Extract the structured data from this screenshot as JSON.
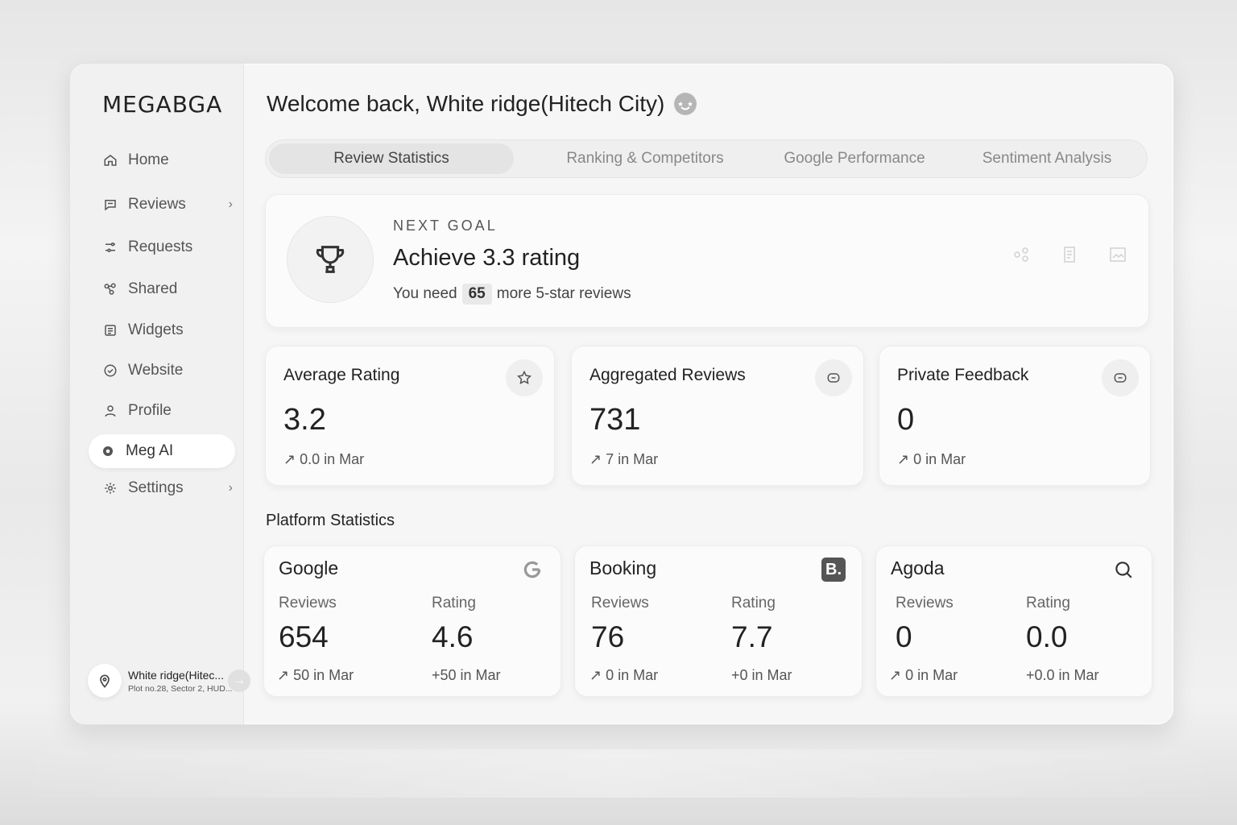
{
  "app": {
    "logo": "MEGABGA"
  },
  "header": {
    "welcome": "Welcome back, White ridge(Hitech City)"
  },
  "sidebar": {
    "items": [
      {
        "label": "Home",
        "icon": "home-icon"
      },
      {
        "label": "Reviews",
        "icon": "chat-icon",
        "has_chevron": true
      },
      {
        "label": "Requests",
        "icon": "sliders-icon"
      },
      {
        "label": "Shared",
        "icon": "share-icon"
      },
      {
        "label": "Widgets",
        "icon": "widget-icon"
      },
      {
        "label": "Website",
        "icon": "check-circle-icon"
      },
      {
        "label": "Profile",
        "icon": "user-icon"
      },
      {
        "label": "Meg AI",
        "icon": "ai-dot-icon",
        "active": true
      },
      {
        "label": "Settings",
        "icon": "gear-icon",
        "has_chevron": true
      }
    ],
    "chevron": "›",
    "account": {
      "name": "White ridge(Hitec...",
      "address": "Plot no.28, Sector 2, HUD...",
      "arrow": "→"
    }
  },
  "tabs": [
    {
      "label": "Review Statistics",
      "active": true
    },
    {
      "label": "Ranking & Competitors"
    },
    {
      "label": "Google Performance"
    },
    {
      "label": "Sentiment Analysis"
    }
  ],
  "goal": {
    "kicker": "NEXT GOAL",
    "title": "Achieve 3.3 rating",
    "need_prefix": "You need",
    "need_count": "65",
    "need_suffix": "more 5-star reviews"
  },
  "stats": [
    {
      "label": "Average Rating",
      "value": "3.2",
      "delta": "↗ 0.0 in Mar",
      "icon": "star-icon"
    },
    {
      "label": "Aggregated Reviews",
      "value": "731",
      "delta": "↗ 7 in Mar",
      "icon": "message-icon"
    },
    {
      "label": "Private Feedback",
      "value": "0",
      "delta": "↗ 0 in Mar",
      "icon": "message-icon"
    }
  ],
  "platform_section_title": "Platform Statistics",
  "platforms": [
    {
      "name": "Google",
      "icon": "google-icon",
      "reviews_label": "Reviews",
      "reviews": "654",
      "reviews_delta": "↗ 50 in Mar",
      "rating_label": "Rating",
      "rating": "4.6",
      "rating_delta": "+50 in Mar"
    },
    {
      "name": "Booking",
      "icon": "booking-icon",
      "badge": "B.",
      "reviews_label": "Reviews",
      "reviews": "76",
      "reviews_delta": "↗ 0 in Mar",
      "rating_label": "Rating",
      "rating": "7.7",
      "rating_delta": "+0 in Mar"
    },
    {
      "name": "Agoda",
      "icon": "search-icon",
      "reviews_label": "Reviews",
      "reviews": "0",
      "reviews_delta": "↗ 0 in Mar",
      "rating_label": "Rating",
      "rating": "0.0",
      "rating_delta": "+0.0 in Mar"
    }
  ]
}
